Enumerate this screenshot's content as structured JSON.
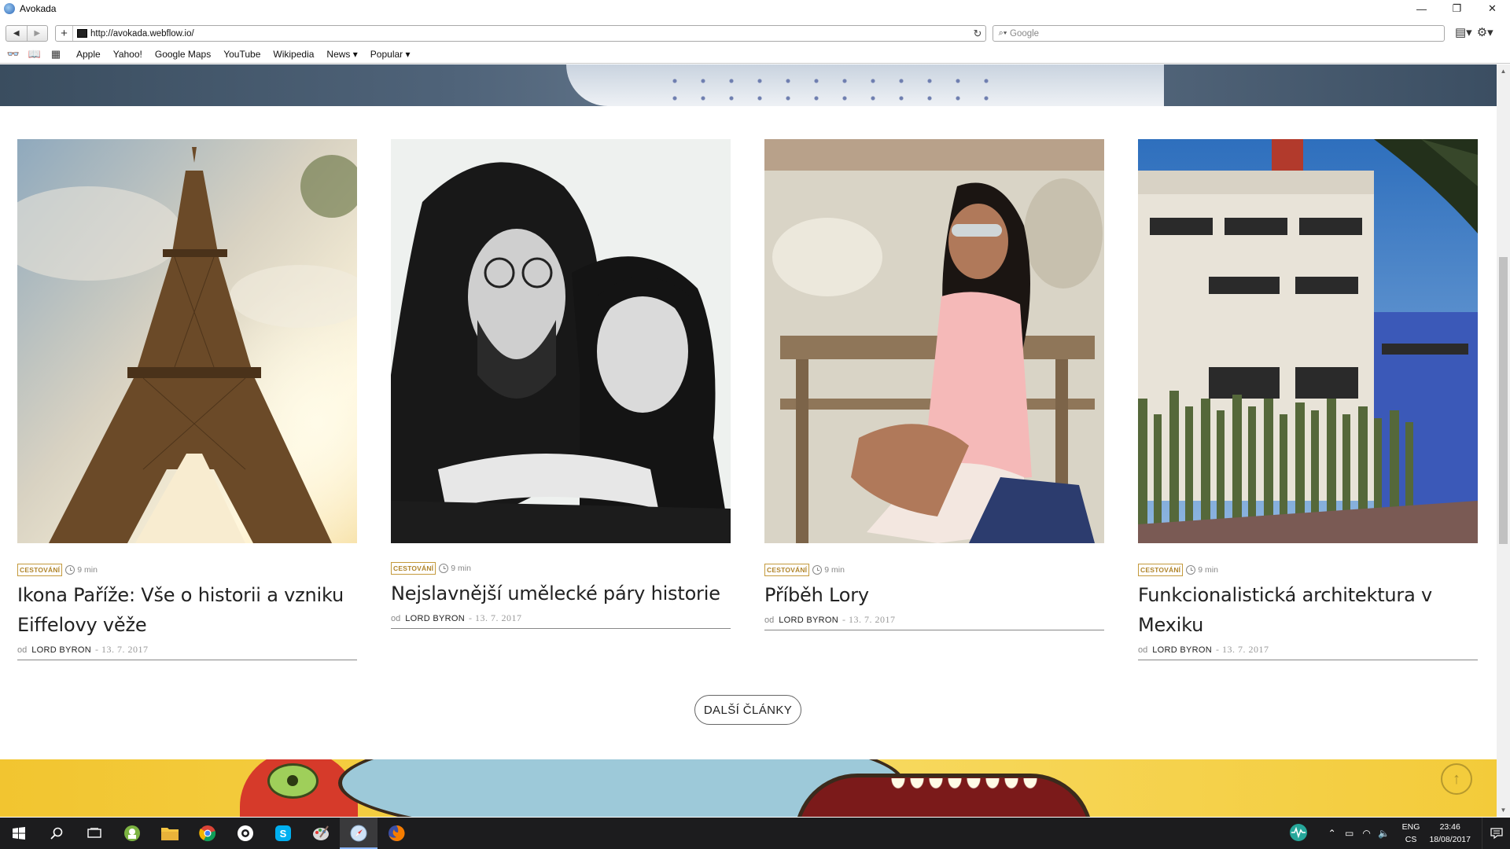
{
  "window": {
    "title": "Avokada",
    "controls": {
      "minimize": "—",
      "restore": "❐",
      "close": "✕"
    }
  },
  "toolbar": {
    "back": "◀",
    "forward": "▶",
    "add_tab": "+",
    "url": "http://avokada.webflow.io/",
    "reload": "↻",
    "search_placeholder": "Google",
    "page_menu": "▤▾",
    "settings_menu": "⚙▾"
  },
  "bookmarks": {
    "reader_icon": "👓",
    "bookmarks_icon": "📖",
    "topsites_icon": "▦",
    "items": [
      "Apple",
      "Yahoo!",
      "Google Maps",
      "YouTube",
      "Wikipedia",
      "News ▾",
      "Popular ▾"
    ]
  },
  "articles": [
    {
      "category": "CESTOVÁNÍ",
      "read_time": "9 min",
      "title": "Ikona Paříže: Vše o historii a vzniku Eiffelovy věže",
      "by": "od",
      "author": "LORD BYRON",
      "date": "- 13. 7. 2017",
      "image": "eiffel-tower-photo"
    },
    {
      "category": "CESTOVÁNÍ",
      "read_time": "9 min",
      "title": "Nejslavnější umělecké páry historie",
      "by": "od",
      "author": "LORD BYRON",
      "date": "- 13. 7. 2017",
      "image": "couple-bw-photo"
    },
    {
      "category": "CESTOVÁNÍ",
      "read_time": "9 min",
      "title": "Příběh Lory",
      "by": "od",
      "author": "LORD BYRON",
      "date": "- 13. 7. 2017",
      "image": "woman-sunglasses-photo"
    },
    {
      "category": "CESTOVÁNÍ",
      "read_time": "9 min",
      "title": "Funkcionalistická architektura v Mexiku",
      "by": "od",
      "author": "LORD BYRON",
      "date": "- 13. 7. 2017",
      "image": "mexico-building-photo"
    }
  ],
  "more_button": "DALŠÍ ČLÁNKY",
  "back_to_top": "↑",
  "taskbar": {
    "apps": [
      "windows-start-icon",
      "search-icon",
      "task-view-icon",
      "android-app-icon",
      "file-explorer-icon",
      "chrome-icon",
      "app-icon-6",
      "skype-icon",
      "paint-icon",
      "safari-icon",
      "firefox-icon"
    ],
    "language": "ENG",
    "layout": "CS",
    "time": "23:46",
    "date": "18/08/2017"
  },
  "colors": {
    "accent_gold": "#c49a3c",
    "taskbar_bg": "#1c1c1e"
  }
}
